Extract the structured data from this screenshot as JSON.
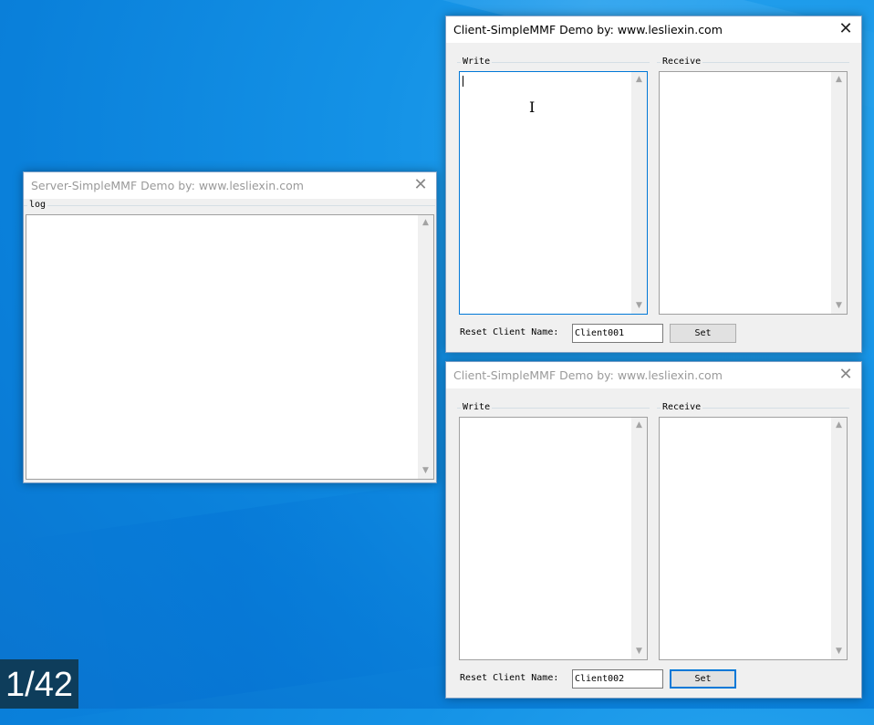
{
  "server": {
    "title": "Server-SimpleMMF Demo   by: www.lesliexin.com",
    "log_label": "log",
    "log_text": ""
  },
  "client1": {
    "title": "Client-SimpleMMF Demo   by: www.lesliexin.com",
    "write_label": "Write",
    "receive_label": "Receive",
    "write_text": "",
    "receive_text": "",
    "reset_label": "Reset Client Name:",
    "name_value": "Client001",
    "set_label": "Set"
  },
  "client2": {
    "title": "Client-SimpleMMF Demo   by: www.lesliexin.com",
    "write_label": "Write",
    "receive_label": "Receive",
    "write_text": "",
    "receive_text": "",
    "reset_label": "Reset Client Name:",
    "name_value": "Client002",
    "set_label": "Set"
  },
  "icons": {
    "close": "✕",
    "scroll_up": "▲",
    "scroll_down": "▼",
    "ibeam": "I"
  },
  "frame_counter": "1/42"
}
